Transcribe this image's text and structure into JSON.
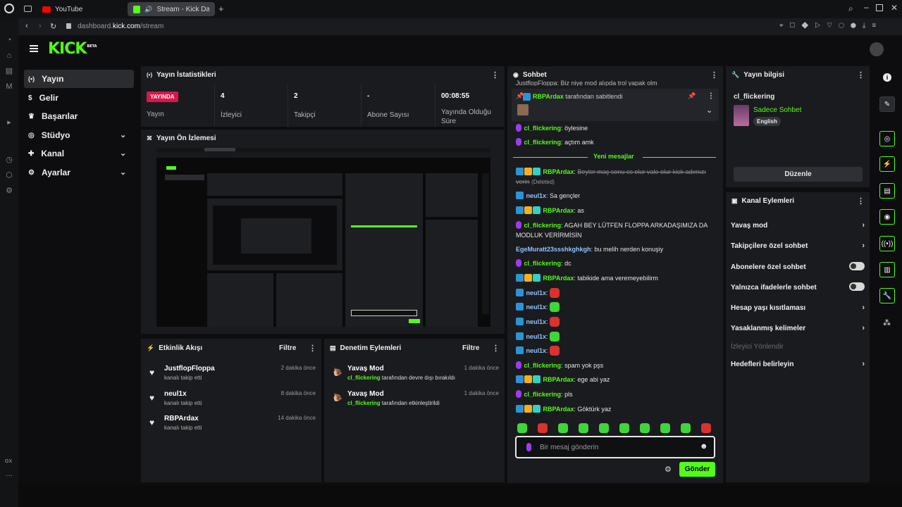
{
  "browser": {
    "tabs": [
      {
        "label": "YouTube"
      },
      {
        "label": "Stream - Kick Dashbo"
      }
    ],
    "url_prefix": "dashboard.",
    "url_host": "kick.com",
    "url_path": "/stream",
    "gx_label": "GX"
  },
  "app": {
    "logo": "KICK",
    "logo_beta": "BETA",
    "accent": "#53fc18"
  },
  "sidebar": {
    "items": [
      {
        "label": "Yayın",
        "icon": "broadcast-icon"
      },
      {
        "label": "Gelir",
        "icon": "dollar-icon"
      },
      {
        "label": "Başarılar",
        "icon": "trophy-icon"
      },
      {
        "label": "Stüdyo",
        "icon": "studio-icon"
      },
      {
        "label": "Kanal",
        "icon": "channel-icon"
      },
      {
        "label": "Ayarlar",
        "icon": "gear-icon"
      }
    ]
  },
  "stats": {
    "title": "Yayın İstatistikleri",
    "live_badge": "YAYINDA",
    "live_label": "Yayın",
    "viewers_value": "4",
    "viewers_label": "İzleyici",
    "followers_value": "2",
    "followers_label": "Takipçi",
    "subs_value": "-",
    "subs_label": "Abone Sayısı",
    "uptime_value": "00:08:55",
    "uptime_label": "Yayında Olduğu Süre"
  },
  "preview": {
    "title": "Yayın Ön İzlemesi"
  },
  "activity": {
    "title": "Etkinlik Akışı",
    "filter": "Filtre",
    "items": [
      {
        "name": "JustflopFloppa",
        "sub": "kanalı takip etti",
        "time": "2 dakika önce"
      },
      {
        "name": "neul1x",
        "sub": "kanalı takip etti",
        "time": "8 dakika önce"
      },
      {
        "name": "RBPArdax",
        "sub": "kanalı takip etti",
        "time": "14 dakika önce"
      }
    ]
  },
  "moderation": {
    "title": "Denetim Eylemleri",
    "filter": "Filtre",
    "items": [
      {
        "name": "Yavaş Mod",
        "user": "cl_flickering",
        "sub": "tarafından devre dışı bırakıldı",
        "time": "1 dakika önce"
      },
      {
        "name": "Yavaş Mod",
        "user": "cl_flickering",
        "sub": "tarafından etkinleştirildi",
        "time": "1 dakika önce"
      }
    ]
  },
  "chat": {
    "title": "Sohbet",
    "top_cut": "JustflopFloppa: Biz niye mod alıpda trol yapak olm",
    "pinned_user": "RBPArdax",
    "pinned_suffix": "tarafından sabitlendi",
    "new_messages": "Yeni mesajlar",
    "messages": [
      {
        "user": "cl_flickering",
        "text": "öylesine"
      },
      {
        "user": "cl_flickering",
        "text": "açtım amk"
      },
      {
        "user": "RBPArdax",
        "text": "Beyler maç sonu cs olur valo olur kick adımızı verin",
        "deleted": "(Deleted)"
      },
      {
        "user": "neul1x",
        "text": "Sa gençler"
      },
      {
        "user": "RBPArdax",
        "text": "as"
      },
      {
        "user": "cl_flickering",
        "text": "AGAH BEY LÜTFEN FLOPPA ARKADAŞIMIZA DA MODLUK VERİRMİSİN"
      },
      {
        "user": "EgeMuratt23ssshkghkgh",
        "text": "bu melih nerden konuşiy"
      },
      {
        "user": "cl_flickering",
        "text": "dc"
      },
      {
        "user": "RBPArdax",
        "text": "tabikide ama veremeyebilirm"
      },
      {
        "user": "neul1x",
        "text": ""
      },
      {
        "user": "neul1x",
        "text": ""
      },
      {
        "user": "neul1x",
        "text": ""
      },
      {
        "user": "neul1x",
        "text": ""
      },
      {
        "user": "neul1x",
        "text": ""
      },
      {
        "user": "cl_flickering",
        "text": "spam yok pşs"
      },
      {
        "user": "RBPArdax",
        "text": "ege abi yaz"
      },
      {
        "user": "cl_flickering",
        "text": "pls"
      },
      {
        "user": "RBPArdax",
        "text": "Göktürk yaz"
      }
    ],
    "input_placeholder": "Bir mesaj gönderin",
    "send_label": "Gönder"
  },
  "info": {
    "title": "Yayın bilgisi",
    "channel": "cl_flickering",
    "category": "Sadece Sohbet",
    "language": "English",
    "edit_label": "Düzenle"
  },
  "channel_actions": {
    "title": "Kanal Eylemleri",
    "items": [
      {
        "label": "Yavaş mod",
        "control": "arrow"
      },
      {
        "label": "Takipçilere özel sohbet",
        "control": "arrow"
      },
      {
        "label": "Abonelere özel sohbet",
        "control": "toggle"
      },
      {
        "label": "Yalnızca ifadelerle sohbet",
        "control": "toggle"
      },
      {
        "label": "Hesap yaşı kısıtlaması",
        "control": "arrow"
      },
      {
        "label": "Yasaklanmış kelimeler",
        "control": "arrow"
      },
      {
        "label": "İzleyici Yönlendir",
        "control": "none"
      },
      {
        "label": "Hedefleri belirleyin",
        "control": "arrow"
      }
    ]
  }
}
